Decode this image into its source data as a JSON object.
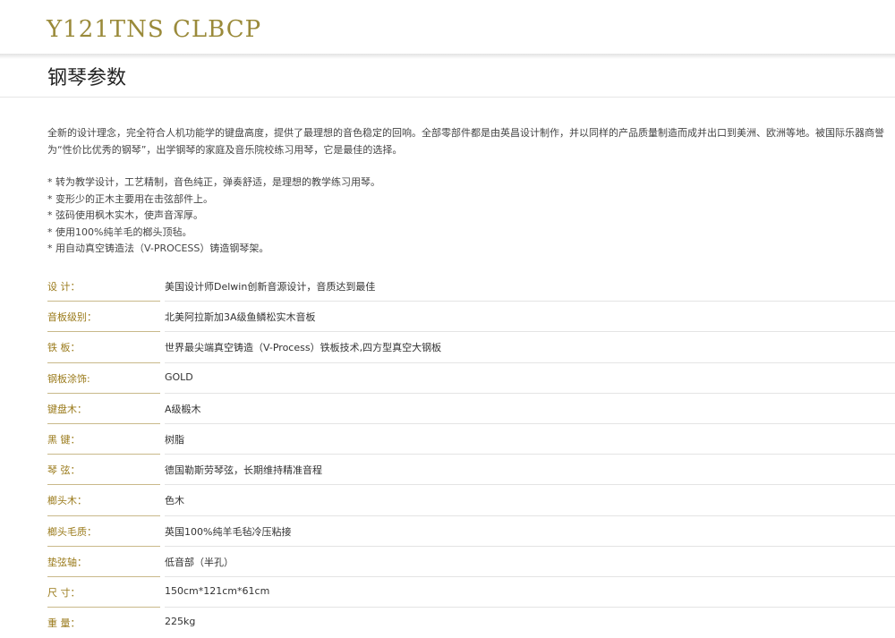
{
  "header": {
    "model": "Y121TNS CLBCP"
  },
  "section": {
    "title": "钢琴参数"
  },
  "intro": {
    "text": "全新的设计理念，完全符合人机功能学的键盘高度，提供了最理想的音色稳定的回响。全部零部件都是由英昌设计制作，并以同样的产品质量制造而成并出口到美洲、欧洲等地。被国际乐器商誉为“性价比优秀的钢琴”，出学钢琴的家庭及音乐院校练习用琴，它是最佳的选择。"
  },
  "features": [
    "*  转为教学设计，工艺精制，音色纯正，弹奏舒适，是理想的教学练习用琴。",
    "*  变形少的正木主要用在击弦部件上。",
    "*  弦码使用枫木实木，使声音浑厚。",
    "*  使用100%纯羊毛的榔头顶毡。",
    "*  用自动真空铸造法（V-PROCESS）铸造钢琴架。"
  ],
  "specs": [
    {
      "label": "设 计：",
      "value": "美国设计师Delwin创新音源设计，音质达到最佳"
    },
    {
      "label": "音板级别：",
      "value": "北美阿拉斯加3A级鱼鳞松实木音板"
    },
    {
      "label": "铁 板：",
      "value": "世界最尖端真空铸造（V-Process）铁板技术,四方型真空大钢板"
    },
    {
      "label": "钢板涂饰:",
      "value": "GOLD"
    },
    {
      "label": "键盘木：",
      "value": "A级椴木"
    },
    {
      "label": "黑 键：",
      "value": "树脂"
    },
    {
      "label": "琴 弦：",
      "value": "德国勒斯劳琴弦，长期维持精准音程"
    },
    {
      "label": "榔头木：",
      "value": "色木"
    },
    {
      "label": "榔头毛质：",
      "value": "英国100%纯羊毛毡冷压粘接"
    },
    {
      "label": "垫弦轴：",
      "value": "低音部（半孔）"
    },
    {
      "label": "尺 寸：",
      "value": "150cm*121cm*61cm"
    },
    {
      "label": "重 量：",
      "value": "225kg"
    }
  ]
}
